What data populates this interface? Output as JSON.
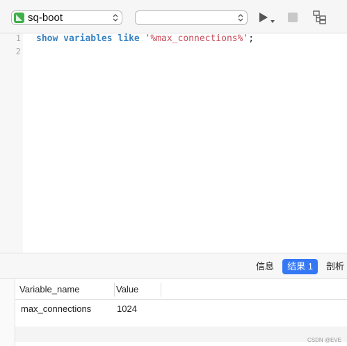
{
  "toolbar": {
    "connection_name": "sq-boot",
    "database_value": "",
    "run_icon": "play-icon",
    "stop_icon": "stop-icon",
    "explain_icon": "explain-icon"
  },
  "editor": {
    "line_numbers": [
      "1",
      "2"
    ],
    "line1": {
      "kw1": "show",
      "kw2": "variables",
      "kw3": "like",
      "string": "'%max_connections%'",
      "terminator": ";"
    }
  },
  "result_tabs": {
    "info": "信息",
    "result": "结果 1",
    "profile": "剖析"
  },
  "grid": {
    "columns": [
      "Variable_name",
      "Value"
    ],
    "rows": [
      [
        "max_connections",
        "1024"
      ]
    ]
  },
  "watermark": "CSDN @EVE",
  "colors": {
    "accent": "#3478f6",
    "keyword": "#3a83c4",
    "string": "#c94c5b",
    "connection_icon": "#3fb049"
  }
}
